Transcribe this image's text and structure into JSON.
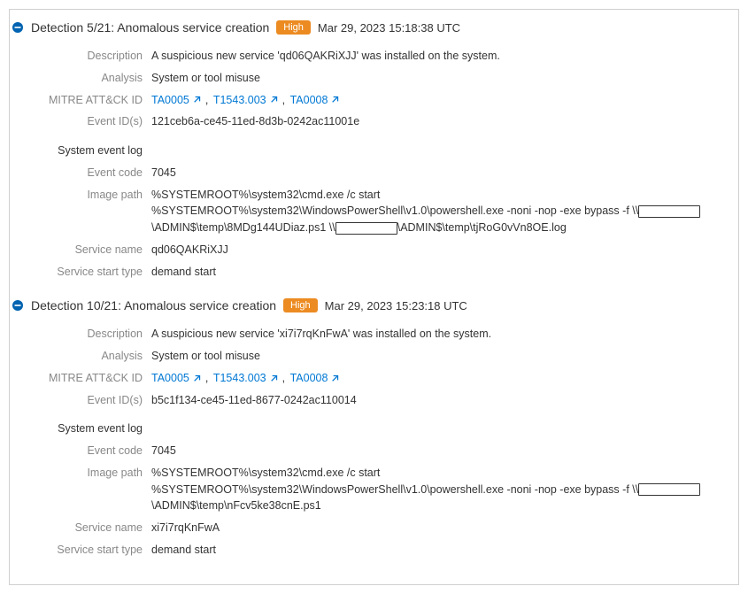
{
  "labels": {
    "description": "Description",
    "analysis": "Analysis",
    "mitre": "MITRE ATT&CK ID",
    "event_ids": "Event ID(s)",
    "sys_log": "System event log",
    "event_code": "Event code",
    "image_path": "Image path",
    "service_name": "Service name",
    "service_start": "Service start type"
  },
  "detections": [
    {
      "title": "Detection 5/21: Anomalous service creation",
      "severity": "High",
      "timestamp": "Mar 29, 2023 15:18:38 UTC",
      "description": "A suspicious new service 'qd06QAKRiXJJ' was installed on the system.",
      "analysis": "System or tool misuse",
      "mitre": [
        {
          "id": "TA0005"
        },
        {
          "id": "T1543.003"
        },
        {
          "id": "TA0008"
        }
      ],
      "event_ids": "121ceb6a-ce45-11ed-8d3b-0242ac11001e",
      "event_code": "7045",
      "image_path_parts": {
        "p1": "%SYSTEMROOT%\\system32\\cmd.exe /c start %SYSTEMROOT%\\system32\\WindowsPowerShell\\v1.0\\powershell.exe -noni -nop -exe bypass -f \\\\",
        "r1_width": 70,
        "p2": "\\ADMIN$\\temp\\8MDg144UDiaz.ps1 \\\\",
        "r2_width": 70,
        "p3": "\\ADMIN$\\temp\\tjRoG0vVn8OE.log"
      },
      "service_name": "qd06QAKRiXJJ",
      "service_start": "demand start"
    },
    {
      "title": "Detection 10/21: Anomalous service creation",
      "severity": "High",
      "timestamp": "Mar 29, 2023 15:23:18 UTC",
      "description": "A suspicious new service 'xi7i7rqKnFwA' was installed on the system.",
      "analysis": "System or tool misuse",
      "mitre": [
        {
          "id": "TA0005"
        },
        {
          "id": "T1543.003"
        },
        {
          "id": "TA0008"
        }
      ],
      "event_ids": "b5c1f134-ce45-11ed-8677-0242ac110014",
      "event_code": "7045",
      "image_path_parts": {
        "p1": "%SYSTEMROOT%\\system32\\cmd.exe /c start %SYSTEMROOT%\\system32\\WindowsPowerShell\\v1.0\\powershell.exe -noni -nop -exe bypass -f \\\\",
        "r1_width": 70,
        "p2": "\\ADMIN$\\temp\\nFcv5ke38cnE.ps1",
        "r2_width": 0,
        "p3": ""
      },
      "service_name": "xi7i7rqKnFwA",
      "service_start": "demand start"
    }
  ]
}
